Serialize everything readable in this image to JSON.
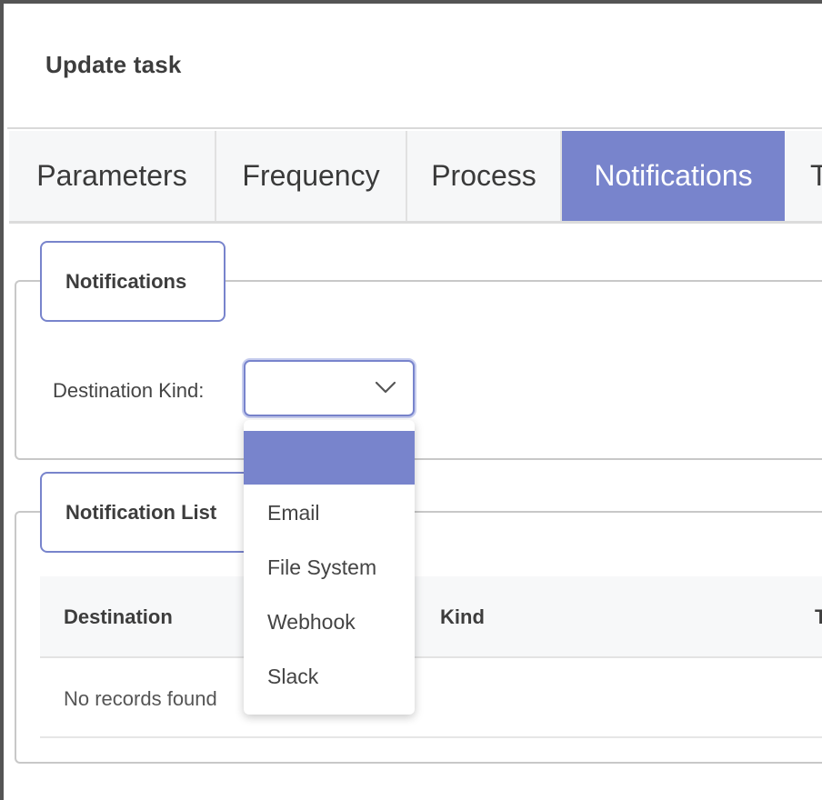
{
  "dialog": {
    "title": "Update task"
  },
  "tabs": [
    {
      "label": "Parameters",
      "active": false
    },
    {
      "label": "Frequency",
      "active": false
    },
    {
      "label": "Process",
      "active": false
    },
    {
      "label": "Notifications",
      "active": true
    },
    {
      "label": "T",
      "active": false
    }
  ],
  "notifications_section": {
    "legend": "Notifications",
    "destination_kind_label": "Destination Kind:",
    "destination_kind_value": "",
    "chevron_icon": "chevron-down-icon",
    "dropdown_options": [
      "",
      "Email",
      "File System",
      "Webhook",
      "Slack"
    ],
    "selected_option_index": 0
  },
  "notification_list": {
    "legend": "Notification List",
    "columns": [
      "Destination",
      "Kind",
      "T"
    ],
    "empty_message": "No records found"
  },
  "colors": {
    "accent": "#7884cc",
    "border": "#c8c8c8",
    "header_bg": "#f6f7f8"
  }
}
